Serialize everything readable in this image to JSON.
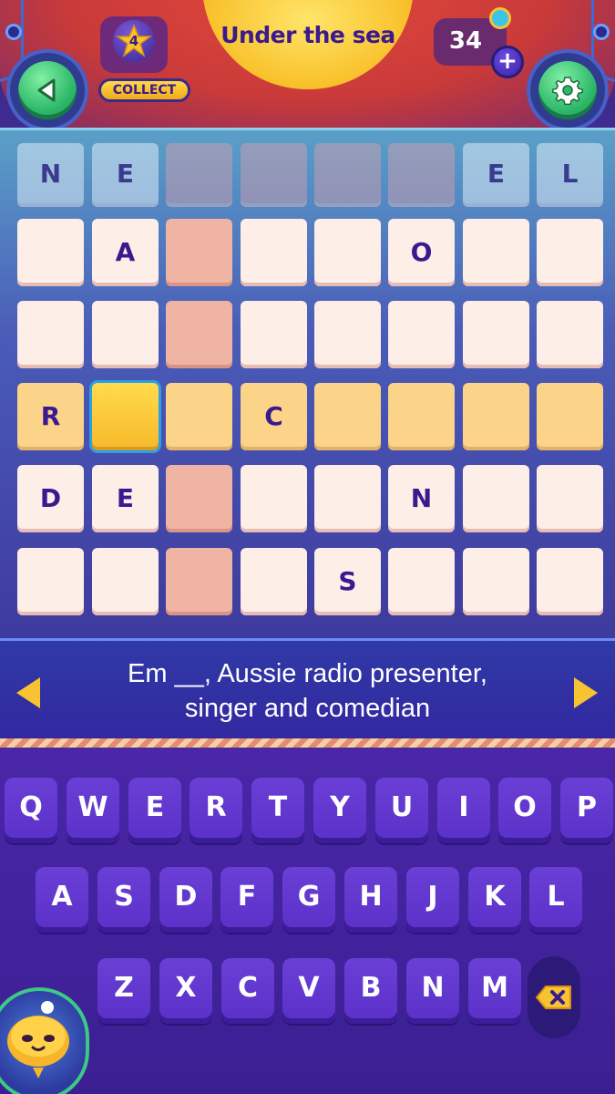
{
  "header": {
    "title": "Under the sea",
    "star_level": "4",
    "collect_label": "COLLECT",
    "coins": "34",
    "add_coins": "+"
  },
  "grid": {
    "rows": [
      [
        "N",
        "E",
        "",
        "",
        "",
        "",
        "E",
        "L"
      ],
      [
        "",
        "A",
        "",
        "",
        "",
        "O",
        "",
        ""
      ],
      [
        "",
        "",
        "",
        "",
        "",
        "",
        "",
        ""
      ],
      [
        "R",
        "",
        "",
        "C",
        "",
        "",
        "",
        ""
      ],
      [
        "D",
        "E",
        "",
        "",
        "",
        "N",
        "",
        ""
      ],
      [
        "",
        "",
        "",
        "",
        "S",
        "",
        "",
        ""
      ]
    ]
  },
  "clue": {
    "line1": "Em __, Aussie radio presenter,",
    "line2": "singer and comedian"
  },
  "keyboard": {
    "row1": [
      "Q",
      "W",
      "E",
      "R",
      "T",
      "Y",
      "U",
      "I",
      "O",
      "P"
    ],
    "row2": [
      "A",
      "S",
      "D",
      "F",
      "G",
      "H",
      "J",
      "K",
      "L"
    ],
    "row3": [
      "Z",
      "X",
      "C",
      "V",
      "B",
      "N",
      "M"
    ]
  },
  "colors": {
    "accent_gold": "#f7c431",
    "cell_active": "#ffdb4c",
    "key_purple": "#6a3fd6"
  }
}
